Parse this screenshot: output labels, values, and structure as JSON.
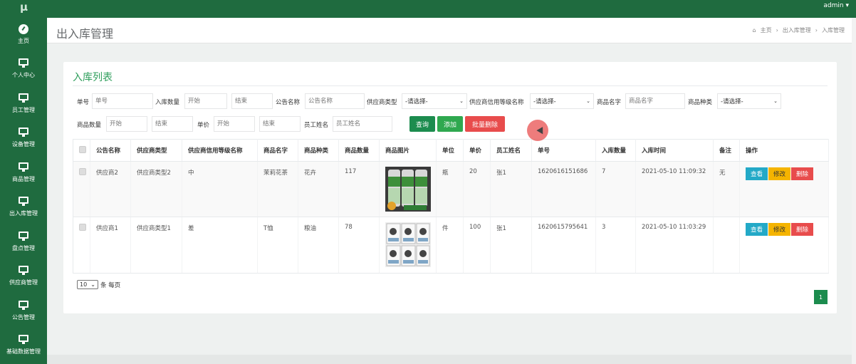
{
  "app": {
    "logo": "μ",
    "user": "admin ▾"
  },
  "sidebar": {
    "items": [
      {
        "label": "主页",
        "icon": "dashboard-icon"
      },
      {
        "label": "个人中心",
        "icon": "monitor-icon"
      },
      {
        "label": "员工管理",
        "icon": "monitor-icon"
      },
      {
        "label": "设备管理",
        "icon": "monitor-icon"
      },
      {
        "label": "商品管理",
        "icon": "monitor-icon"
      },
      {
        "label": "出入库管理",
        "icon": "monitor-icon"
      },
      {
        "label": "盘点管理",
        "icon": "monitor-icon"
      },
      {
        "label": "供应商管理",
        "icon": "monitor-icon"
      },
      {
        "label": "公告管理",
        "icon": "monitor-icon"
      },
      {
        "label": "基础数据管理",
        "icon": "monitor-icon"
      }
    ]
  },
  "header": {
    "title": "出入库管理",
    "breadcrumb": [
      "主页",
      "出入库管理",
      "入库管理"
    ],
    "breadcrumb_sep": "›"
  },
  "panel": {
    "title": "入库列表"
  },
  "filters": {
    "dan_hao_label": "单号",
    "dan_hao_placeholder": "单号",
    "ruku_qty_label": "入库数量",
    "ruku_qty_start": "开始",
    "ruku_qty_end_label": "结束",
    "notice_label": "公告名称",
    "notice_placeholder": "公告名称",
    "supplier_type_label": "供应商类型",
    "supplier_type_value": "-请选择-",
    "supplier_level_label": "供应商信用等级名称",
    "supplier_level_value": "-请选择-",
    "goods_name_label": "商品名字",
    "goods_name_placeholder": "商品名字",
    "goods_kind_label": "商品种类",
    "goods_kind_value": "-请选择-",
    "goods_qty_label": "商品数量",
    "goods_qty_start": "开始",
    "goods_qty_end": "结束",
    "price_label": "单价",
    "price_start": "开始",
    "price_end": "结束",
    "employee_label": "员工姓名",
    "employee_placeholder": "员工姓名"
  },
  "buttons": {
    "search": "查询",
    "add": "添加",
    "batch_delete": "批量删除"
  },
  "table": {
    "columns": [
      "公告名称",
      "供应商类型",
      "供应商信用等级名称",
      "商品名字",
      "商品种类",
      "商品数量",
      "商品图片",
      "单位",
      "单价",
      "员工姓名",
      "单号",
      "入库数量",
      "入库时间",
      "备注",
      "操作"
    ],
    "rows": [
      {
        "notice": "供应商2",
        "stype": "供应商类型2",
        "level": "中",
        "gname": "茉莉花茶",
        "gkind": "花卉",
        "gqty": "117",
        "unit": "瓶",
        "price": "20",
        "emp": "张1",
        "no": "1620616151686",
        "inqty": "7",
        "time": "2021-05-10 11:09:32",
        "note": "无"
      },
      {
        "notice": "供应商1",
        "stype": "供应商类型1",
        "level": "差",
        "gname": "T恤",
        "gkind": "粮油",
        "gqty": "78",
        "unit": "件",
        "price": "100",
        "emp": "张1",
        "no": "1620615795641",
        "inqty": "3",
        "time": "2021-05-10 11:03:29",
        "note": ""
      }
    ],
    "ops": {
      "view": "查看",
      "edit": "修改",
      "del": "删除"
    }
  },
  "pager": {
    "size": "10",
    "suffix": "条 每页",
    "current": "1"
  },
  "colors": {
    "brand": "#1f6b3f",
    "accent": "#2e9e5b",
    "danger": "#e84c4c",
    "info": "#23a9c7",
    "warning": "#f5b400"
  }
}
